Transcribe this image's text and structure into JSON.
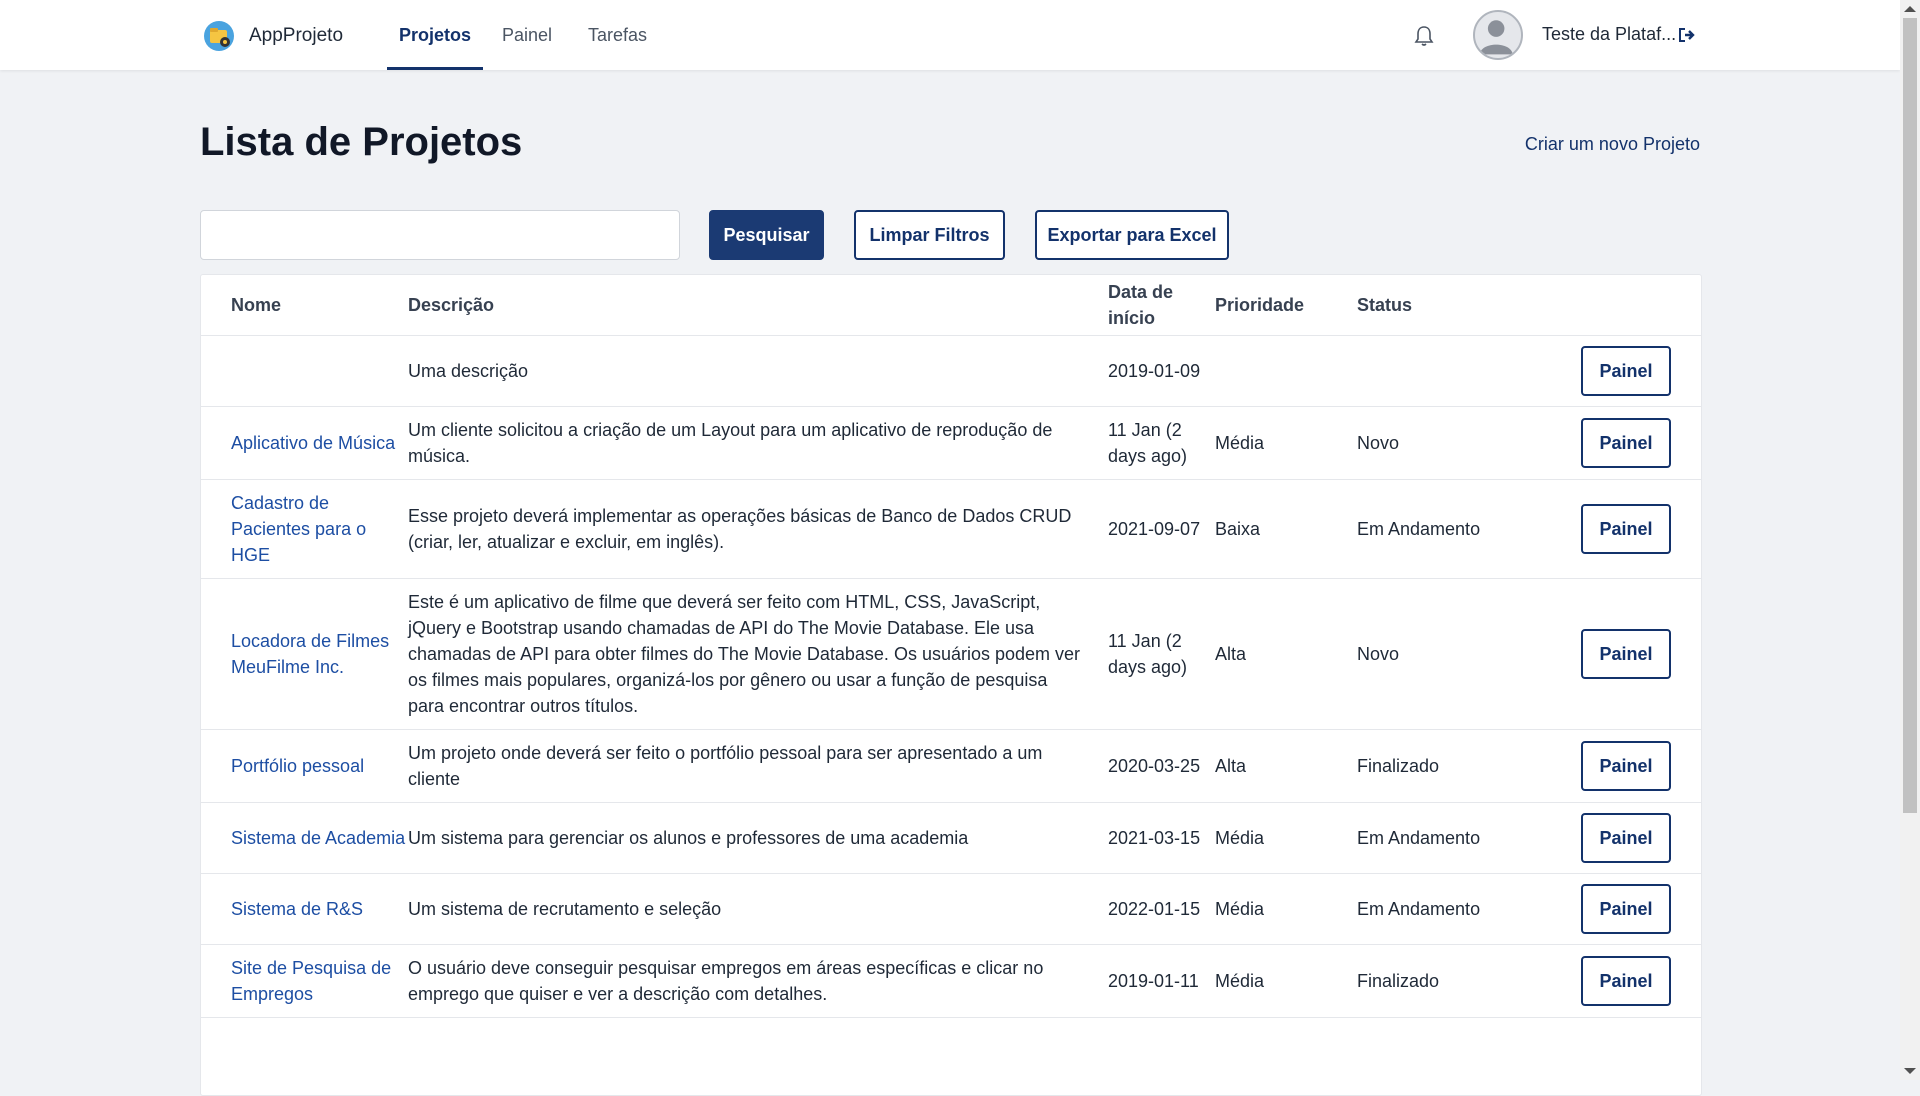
{
  "nav": {
    "app_name": "AppProjeto",
    "tabs": [
      {
        "label": "Projetos",
        "active": true
      },
      {
        "label": "Painel",
        "active": false
      },
      {
        "label": "Tarefas",
        "active": false
      }
    ],
    "user_name": "Teste da Plataf...",
    "icons": {
      "bell": "bell-icon",
      "logout": "logout-icon",
      "avatar": "user-avatar-icon"
    }
  },
  "page": {
    "title": "Lista de Projetos",
    "new_project_link": "Criar um novo Projeto"
  },
  "toolbar": {
    "search_value": "",
    "search_label": "Pesquisar",
    "clear_label": "Limpar Filtros",
    "export_label": "Exportar para Excel"
  },
  "table": {
    "headers": {
      "name": "Nome",
      "description": "Descrição",
      "start_date": "Data de início",
      "priority": "Prioridade",
      "status": "Status"
    },
    "rows": [
      {
        "name": "",
        "description": "Uma descrição",
        "start_date": "2019-01-09",
        "priority": "",
        "status": "",
        "action": "Painel"
      },
      {
        "name": "Aplicativo de Música",
        "description": "Um cliente solicitou a criação de um Layout para um aplicativo de reprodução de música.",
        "start_date": "11 Jan (2 days ago)",
        "priority": "Média",
        "status": "Novo",
        "action": "Painel"
      },
      {
        "name": "Cadastro de Pacientes para o HGE",
        "description": "Esse projeto deverá implementar as operações básicas de Banco de Dados CRUD (criar, ler, atualizar e excluir, em inglês).",
        "start_date": "2021-09-07",
        "priority": "Baixa",
        "status": "Em Andamento",
        "action": "Painel"
      },
      {
        "name": "Locadora de Filmes MeuFilme Inc.",
        "description": "Este é um aplicativo de filme que deverá ser feito com HTML, CSS, JavaScript, jQuery e Bootstrap usando chamadas de API do The Movie Database. Ele usa chamadas de API para obter filmes do The Movie Database. Os usuários podem ver os filmes mais populares, organizá-los por gênero ou usar a função de pesquisa para encontrar outros títulos.",
        "start_date": "11 Jan (2 days ago)",
        "priority": "Alta",
        "status": "Novo",
        "action": "Painel"
      },
      {
        "name": "Portfólio pessoal",
        "description": "Um projeto onde deverá ser feito o portfólio pessoal para ser apresentado a um cliente",
        "start_date": "2020-03-25",
        "priority": "Alta",
        "status": "Finalizado",
        "action": "Painel"
      },
      {
        "name": "Sistema de Academia",
        "description": "Um sistema para gerenciar os alunos e professores de uma academia",
        "start_date": "2021-03-15",
        "priority": "Média",
        "status": "Em Andamento",
        "action": "Painel"
      },
      {
        "name": "Sistema de R&S",
        "description": "Um sistema de recrutamento e seleção",
        "start_date": "2022-01-15",
        "priority": "Média",
        "status": "Em Andamento",
        "action": "Painel"
      },
      {
        "name": "Site de Pesquisa de Empregos",
        "description": "O usuário deve conseguir pesquisar empregos em áreas específicas e clicar no emprego que quiser e ver a descrição com detalhes.",
        "start_date": "2019-01-11",
        "priority": "Média",
        "status": "Finalizado",
        "action": "Painel"
      }
    ]
  },
  "colors": {
    "primary": "#1b3a73",
    "link": "#1d4ea3",
    "background": "#f0f2f5"
  }
}
